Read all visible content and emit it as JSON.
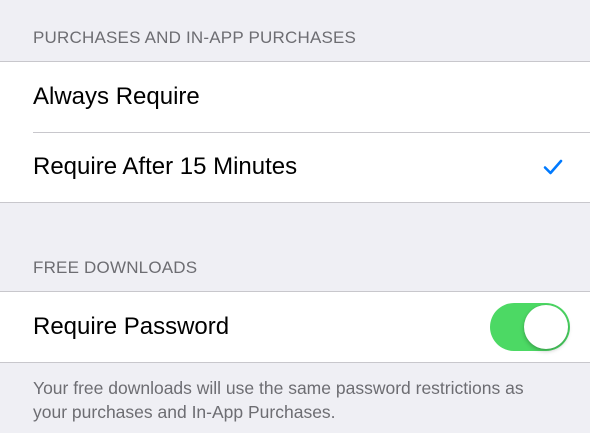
{
  "purchases_section": {
    "header": "PURCHASES AND IN-APP PURCHASES",
    "options": [
      {
        "label": "Always Require",
        "selected": false
      },
      {
        "label": "Require After 15 Minutes",
        "selected": true
      }
    ],
    "checkmark_icon": "checkmark-icon"
  },
  "free_downloads_section": {
    "header": "FREE DOWNLOADS",
    "require_password": {
      "label": "Require Password",
      "enabled": true
    },
    "footer": "Your free downloads will use the same password restrictions as your purchases and In-App Purchases."
  },
  "colors": {
    "tint": "#007aff",
    "toggle_on": "#4cd964",
    "background": "#efeff4",
    "secondary_text": "#6d6d72"
  }
}
